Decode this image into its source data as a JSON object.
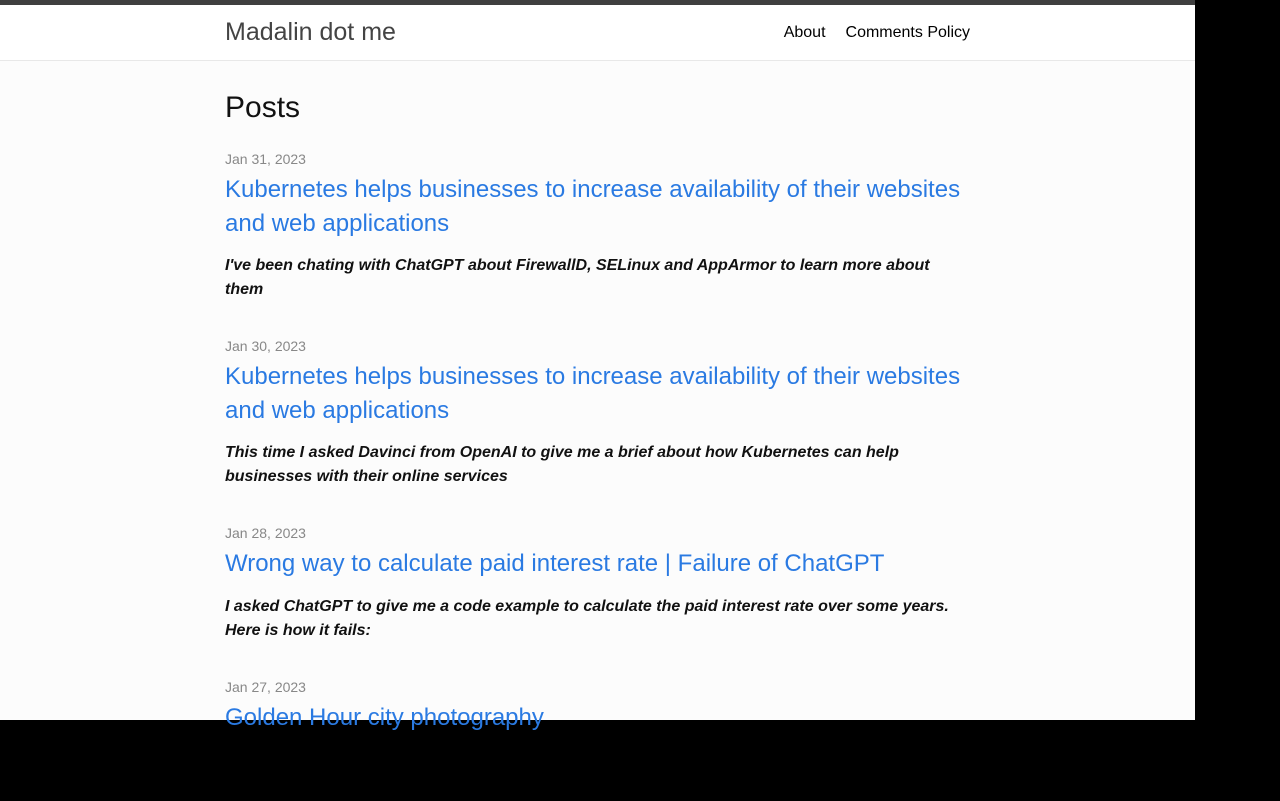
{
  "header": {
    "siteTitle": "Madalin dot me",
    "nav": {
      "about": "About",
      "commentsPolicy": "Comments Policy"
    }
  },
  "main": {
    "title": "Posts",
    "posts": [
      {
        "date": "Jan 31, 2023",
        "title": "Kubernetes helps businesses to increase availability of their websites and web applications",
        "excerpt": "I've been chating with ChatGPT about FirewallD, SELinux and AppArmor to learn more about them"
      },
      {
        "date": "Jan 30, 2023",
        "title": "Kubernetes helps businesses to increase availability of their websites and web applications",
        "excerpt": "This time I asked Davinci from OpenAI to give me a brief about how Kubernetes can help businesses with their online services"
      },
      {
        "date": "Jan 28, 2023",
        "title": "Wrong way to calculate paid interest rate | Failure of ChatGPT",
        "excerpt": "I asked ChatGPT to give me a code example to calculate the paid interest rate over some years. Here is how it fails:"
      },
      {
        "date": "Jan 27, 2023",
        "title": "Golden Hour city photography",
        "excerpt": ""
      }
    ]
  }
}
